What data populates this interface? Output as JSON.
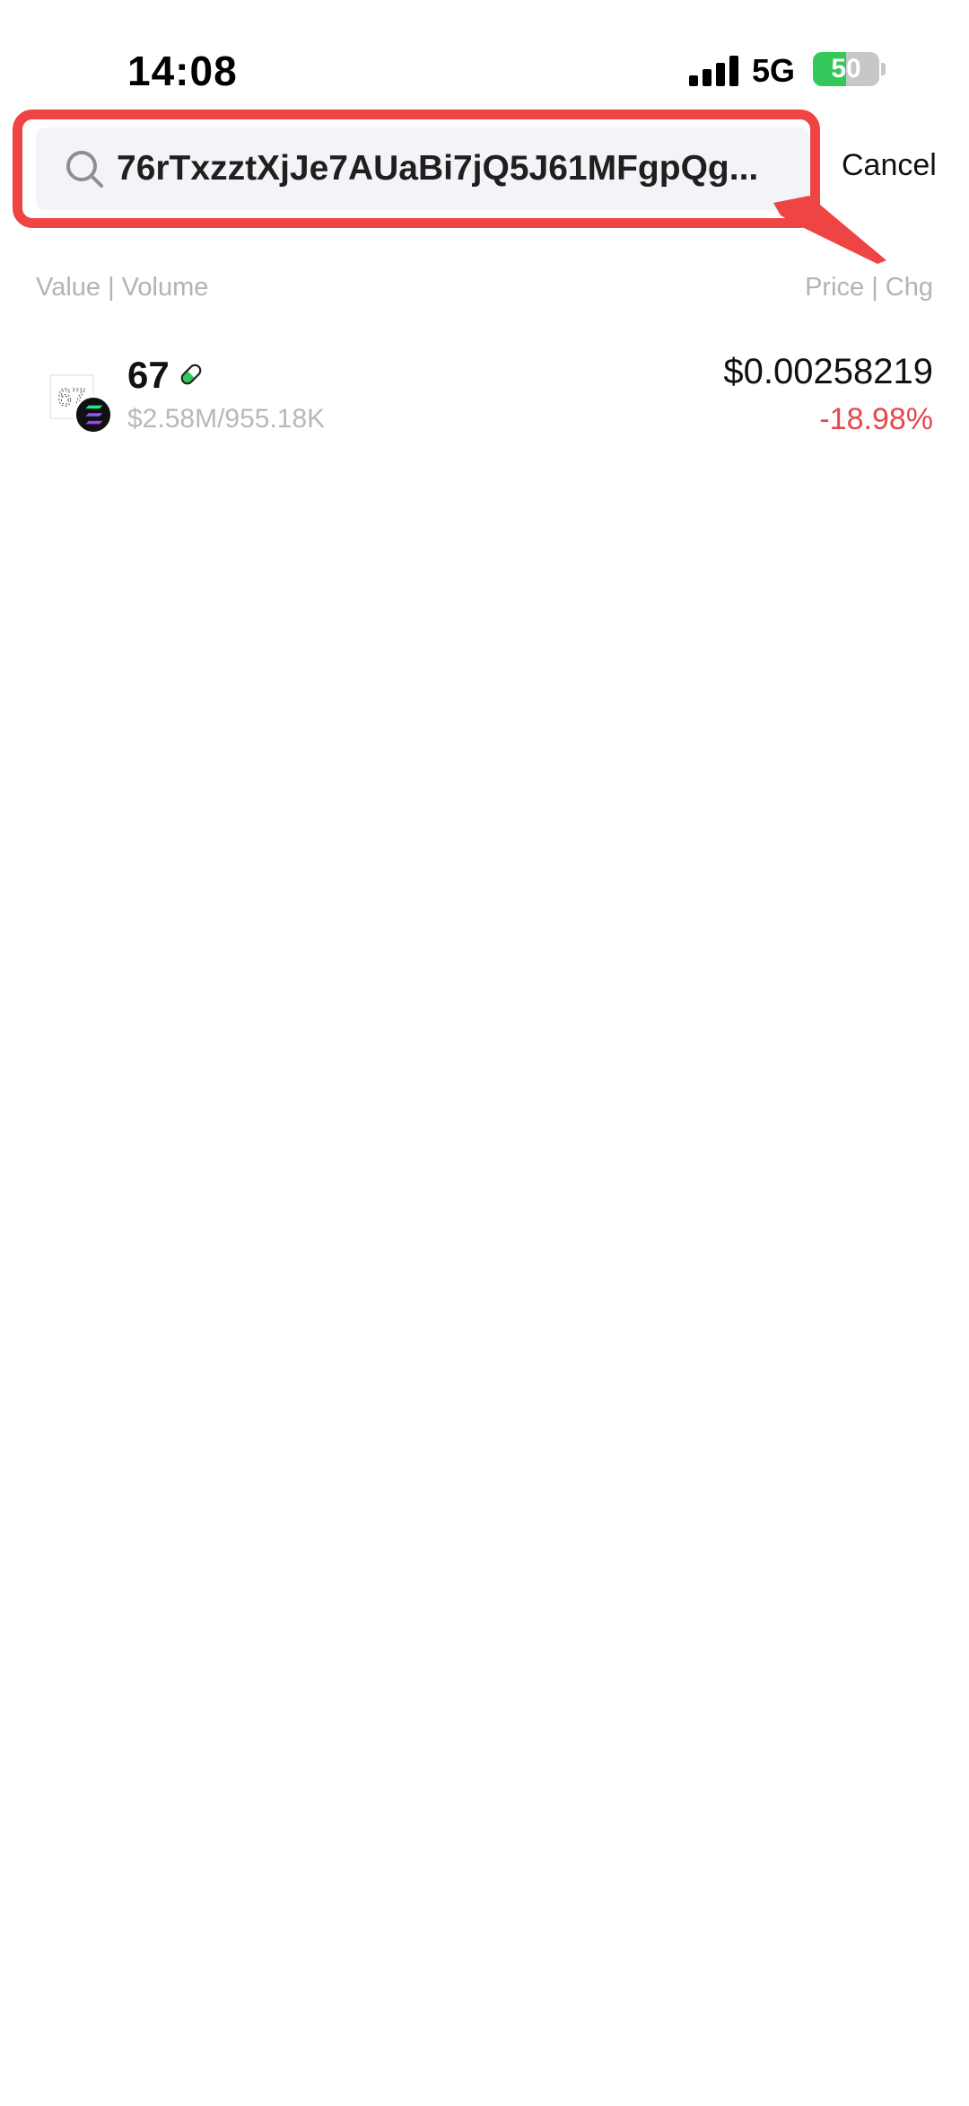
{
  "status_bar": {
    "time": "14:08",
    "network": "5G",
    "battery": "50"
  },
  "search": {
    "value": "76rTxzztXjJe7AUaBi7jQ5J61MFgpQg...",
    "cancel_label": "Cancel",
    "highlight_color": "#ef4444"
  },
  "columns": {
    "left": "Value | Volume",
    "right": "Price | Chg"
  },
  "results": [
    {
      "name": "67",
      "logo_text": "67",
      "volume": "$2.58M/955.18K",
      "price": "$0.00258219",
      "change": "-18.98%",
      "change_color": "#e5484d"
    }
  ]
}
